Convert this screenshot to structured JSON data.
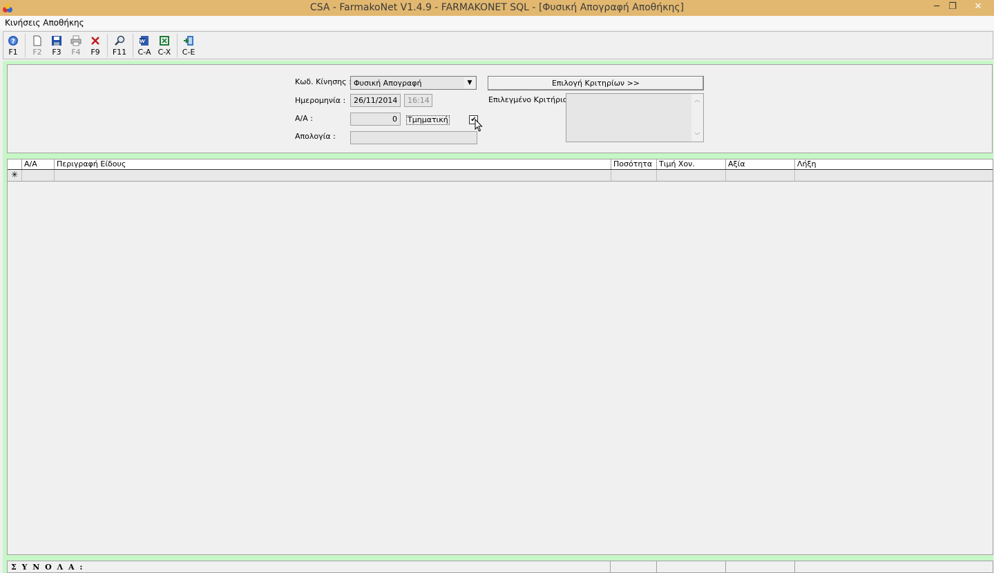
{
  "window": {
    "title": "CSA - FarmakoNet V1.4.9 - FARMAKONET SQL - [Φυσική Απογραφή Αποθήκης]",
    "minimize": "─",
    "restore": "❐",
    "close": "✕"
  },
  "menu": {
    "items": [
      "Κινήσεις Αποθήκης"
    ]
  },
  "toolbar": {
    "buttons": [
      {
        "label": "F1",
        "icon": "help-icon",
        "enabled": true
      },
      {
        "label": "F2",
        "icon": "new-document-icon",
        "enabled": false
      },
      {
        "label": "F3",
        "icon": "save-icon",
        "enabled": true
      },
      {
        "label": "F4",
        "icon": "print-icon",
        "enabled": false
      },
      {
        "label": "F9",
        "icon": "delete-icon",
        "enabled": true
      },
      {
        "label": "F11",
        "icon": "search-icon",
        "enabled": true
      },
      {
        "label": "C-A",
        "icon": "word-export-icon",
        "enabled": true
      },
      {
        "label": "C-X",
        "icon": "excel-export-icon",
        "enabled": true
      },
      {
        "label": "C-E",
        "icon": "exit-icon",
        "enabled": true
      }
    ]
  },
  "form": {
    "movement_code_label": "Κωδ. Κίνησης :",
    "movement_code_value": "Φυσική Απογραφή",
    "date_label": "Ημερομηνία :",
    "date_value": "26/11/2014",
    "time_value": "16:14",
    "serial_label": "Α/Α :",
    "serial_value": "0",
    "partial_label": "Τμηματική",
    "partial_checked": true,
    "reason_label": "Απολογία :",
    "reason_value": "",
    "criteria_button": "Επιλογή Κριτηρίων >>",
    "selected_criterion_label": "Επιλεγμένο Κριτήριο :"
  },
  "grid": {
    "columns": [
      "Α/Α",
      "Περιγραφή Είδους",
      "Ποσότητα",
      "Τιμή Χον.",
      "Αξία",
      "Λήξη"
    ],
    "new_row_marker": "✳"
  },
  "totals": {
    "label": "Σ Υ Ν Ο Λ Α :"
  },
  "colors": {
    "titlebar": "#e2b870",
    "frame_green": "#c7f7c7",
    "panel": "#f0f0f0"
  }
}
